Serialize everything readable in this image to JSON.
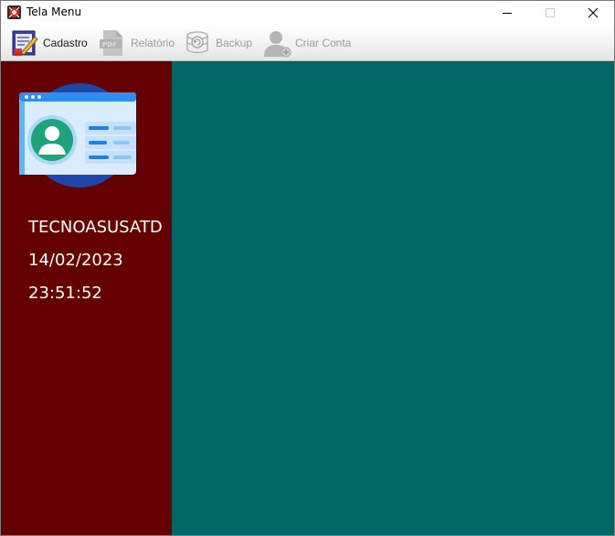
{
  "window": {
    "title": "Tela Menu",
    "app_icon": "app-logo-icon",
    "controls": [
      "minimize-icon",
      "maximize-icon",
      "close-icon"
    ]
  },
  "toolbar": {
    "items": [
      {
        "label": "Cadastro",
        "icon": "register-form-icon",
        "enabled": true
      },
      {
        "label": "Relatório",
        "icon": "pdf-report-icon",
        "enabled": false
      },
      {
        "label": "Backup",
        "icon": "database-backup-icon",
        "enabled": false
      },
      {
        "label": "Criar Conta",
        "icon": "add-user-icon",
        "enabled": false
      }
    ]
  },
  "sidebar": {
    "illustration": "user-id-card-icon",
    "hostname": "TECNOASUSATD",
    "date": "14/02/2023",
    "time": "23:51:52"
  },
  "colors": {
    "sidebar_bg": "#640000",
    "main_bg": "#006766",
    "toolbar_disabled_text": "#9a9a9a"
  }
}
